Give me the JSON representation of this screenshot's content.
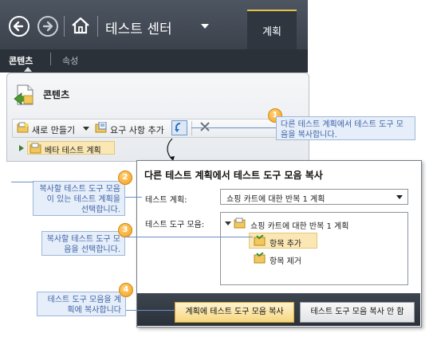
{
  "header": {
    "app_title": "테스트 센터",
    "plan_tab": "계획"
  },
  "subnav": {
    "contents": "콘텐츠",
    "properties": "속성"
  },
  "panel": {
    "title": "콘텐츠",
    "toolbar": {
      "new_label": "새로 만들기",
      "requirements_label": "요구 사항 추가"
    },
    "tree": {
      "root_label": "베타 테스트 계획"
    }
  },
  "callouts": [
    {
      "number": "1",
      "text": "다른 테스트 계획에서 테스트 도구 모음을 복사합니다."
    },
    {
      "number": "2",
      "text": "복사할 테스트 도구 모음이 있는 테스트 계획을 선택합니다."
    },
    {
      "number": "3",
      "text": "복사할 테스트 도구 모음을 선택합니다."
    },
    {
      "number": "4",
      "text": "테스트 도구 모음을 계획에 복사합니다"
    }
  ],
  "dialog": {
    "title": "다른 테스트 계획에서 테스트 도구 모음 복사",
    "plan_label": "테스트 계획:",
    "plan_value": "쇼핑 카트에 대한 반복 1 계획",
    "suite_label": "테스트 도구 모음:",
    "suite_tree": {
      "root": "쇼핑 카트에 대한 반복 1 계획",
      "children": [
        "항목 추가",
        "항목 제거"
      ]
    },
    "copy_button": "계획에 테스트 도구 모음 복사",
    "cancel_button": "테스트 도구 모음 복사 안 함"
  },
  "colors": {
    "accent": "#e9c24a",
    "callout_text": "#3f63a8",
    "callout_badge": "#f29f1a",
    "header_bg": "#434a54"
  },
  "icons": [
    "back-arrow-icon",
    "forward-arrow-icon",
    "home-icon",
    "chevron-down-icon",
    "document-icon",
    "new-suite-icon",
    "requirements-icon",
    "copy-suite-icon",
    "delete-icon",
    "test-suite-icon"
  ]
}
